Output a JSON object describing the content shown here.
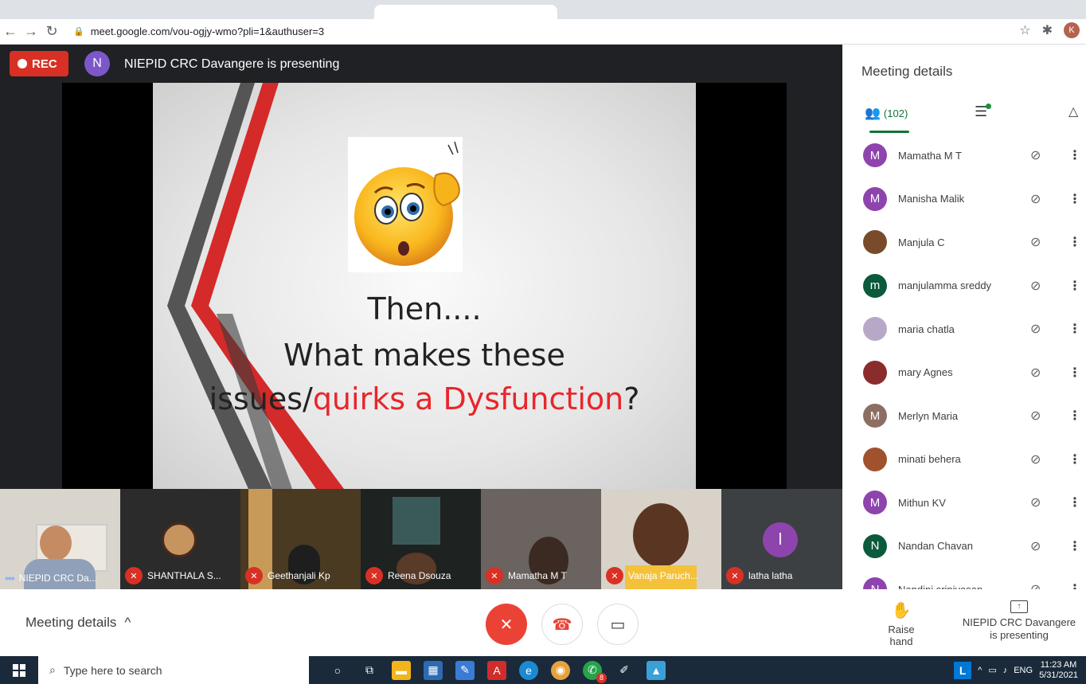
{
  "browser": {
    "url": "meet.google.com/vou-ogjy-wmo?pli=1&authuser=3",
    "profile_initial": "K"
  },
  "stage": {
    "rec_label": "REC",
    "presenter_initial": "N",
    "presenting_text": "NIEPID CRC Davangere is presenting"
  },
  "slide": {
    "line1": "Then....",
    "line2": "What makes these",
    "line3_a": "issues/",
    "line3_b": "quirks a Dysfunction",
    "line3_c": "?"
  },
  "filmstrip": [
    {
      "name": "NIEPID CRC Da...",
      "state": "speaking"
    },
    {
      "name": "SHANTHALA S...",
      "state": "muted"
    },
    {
      "name": "Geethanjali Kp",
      "state": "muted"
    },
    {
      "name": "Reena Dsouza",
      "state": "muted"
    },
    {
      "name": "Mamatha M T",
      "state": "muted"
    },
    {
      "name": "Vanaja Paruch...",
      "state": "muted"
    },
    {
      "name": "latha latha",
      "state": "muted",
      "initial": "l"
    }
  ],
  "panel": {
    "title": "Meeting details",
    "people_count": "(102)",
    "participants": [
      {
        "name": "Mamatha M T",
        "initial": "M",
        "color": "#8e44ad"
      },
      {
        "name": "Manisha Malik",
        "initial": "M",
        "color": "#8e44ad"
      },
      {
        "name": "Manjula C",
        "initial": "",
        "color": "#7a4b2a"
      },
      {
        "name": "manjulamma sreddy",
        "initial": "m",
        "color": "#0b5a3c"
      },
      {
        "name": "maria chatla",
        "initial": "",
        "color": "#b8a8c8"
      },
      {
        "name": "mary Agnes",
        "initial": "",
        "color": "#8b2c2c"
      },
      {
        "name": "Merlyn Maria",
        "initial": "M",
        "color": "#8d6e63"
      },
      {
        "name": "minati behera",
        "initial": "",
        "color": "#a0522d"
      },
      {
        "name": "Mithun KV",
        "initial": "M",
        "color": "#8e44ad"
      },
      {
        "name": "Nandan Chavan",
        "initial": "N",
        "color": "#0b5a3c"
      },
      {
        "name": "Nandini srinivasan",
        "initial": "N",
        "color": "#8e44ad"
      }
    ]
  },
  "bottombar": {
    "meeting_details_label": "Meeting details",
    "raise_hand_label": "Raise hand",
    "presenting_label_1": "NIEPID CRC Davangere",
    "presenting_label_2": "is presenting"
  },
  "taskbar": {
    "search_placeholder": "Type here to search",
    "lang": "ENG",
    "time": "11:23 AM",
    "date": "5/31/2021",
    "whatsapp_badge": "8"
  },
  "colors": {
    "meet_green": "#137333",
    "rec_red": "#d93025",
    "hangup_red": "#ea4335",
    "slide_red_text": "#e8262b"
  }
}
